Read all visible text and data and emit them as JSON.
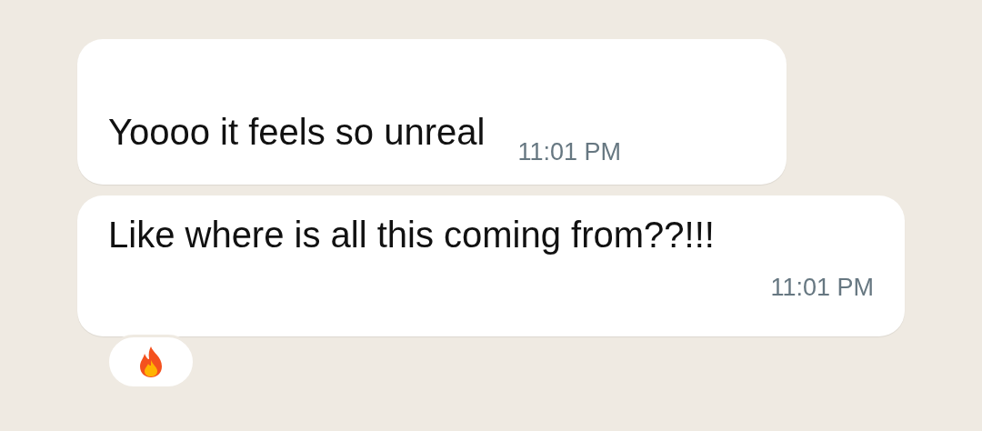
{
  "messages": [
    {
      "kind": "inline",
      "text": "Yoooo it feels so unreal",
      "time": "11:01 PM"
    },
    {
      "kind": "stacked",
      "text": "Like where is all this coming from??!!!",
      "time": "11:01 PM",
      "reacted": true
    }
  ]
}
